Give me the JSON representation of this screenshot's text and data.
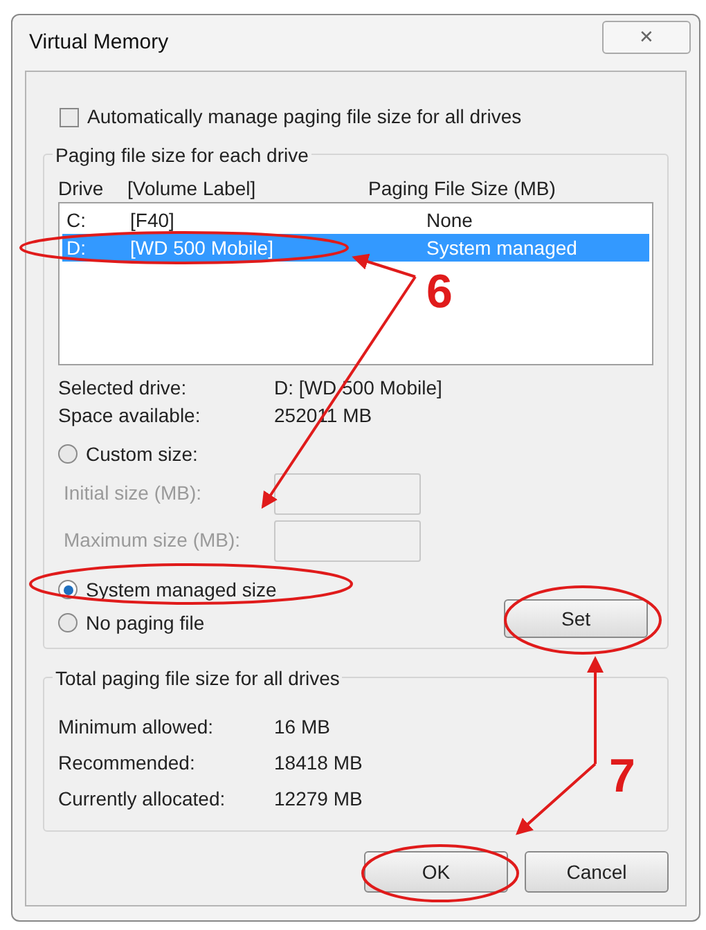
{
  "window": {
    "title": "Virtual Memory",
    "close": "✕"
  },
  "auto_manage": {
    "label": "Automatically manage paging file size for all drives",
    "checked": false
  },
  "drive_group": {
    "title": "Paging file size for each drive",
    "columns": [
      "Drive",
      "[Volume Label]",
      "Paging File Size (MB)"
    ],
    "rows": [
      {
        "drive": "C:",
        "label": "[F40]",
        "size": "None",
        "selected": false
      },
      {
        "drive": "D:",
        "label": "[WD 500 Mobile]",
        "size": "System managed",
        "selected": true
      }
    ],
    "info": [
      {
        "label": "Selected drive:",
        "value": "D:  [WD 500 Mobile]"
      },
      {
        "label": "Space available:",
        "value": "252011 MB"
      }
    ],
    "options": [
      {
        "label": "Custom size:",
        "selected": false
      },
      {
        "label": "System managed size",
        "selected": true
      },
      {
        "label": "No paging file",
        "selected": false
      }
    ],
    "fields": [
      {
        "label": "Initial size (MB):",
        "disabled": true
      },
      {
        "label": "Maximum size (MB):",
        "disabled": true
      }
    ],
    "set_button": "Set"
  },
  "total_group": {
    "title": "Total paging file size for all drives",
    "rows": [
      {
        "label": "Minimum allowed:",
        "value": "16 MB"
      },
      {
        "label": "Recommended:",
        "value": "18418 MB"
      },
      {
        "label": "Currently allocated:",
        "value": "12279 MB"
      }
    ]
  },
  "buttons": [
    "OK",
    "Cancel"
  ],
  "annotations": [
    "6",
    "7"
  ]
}
